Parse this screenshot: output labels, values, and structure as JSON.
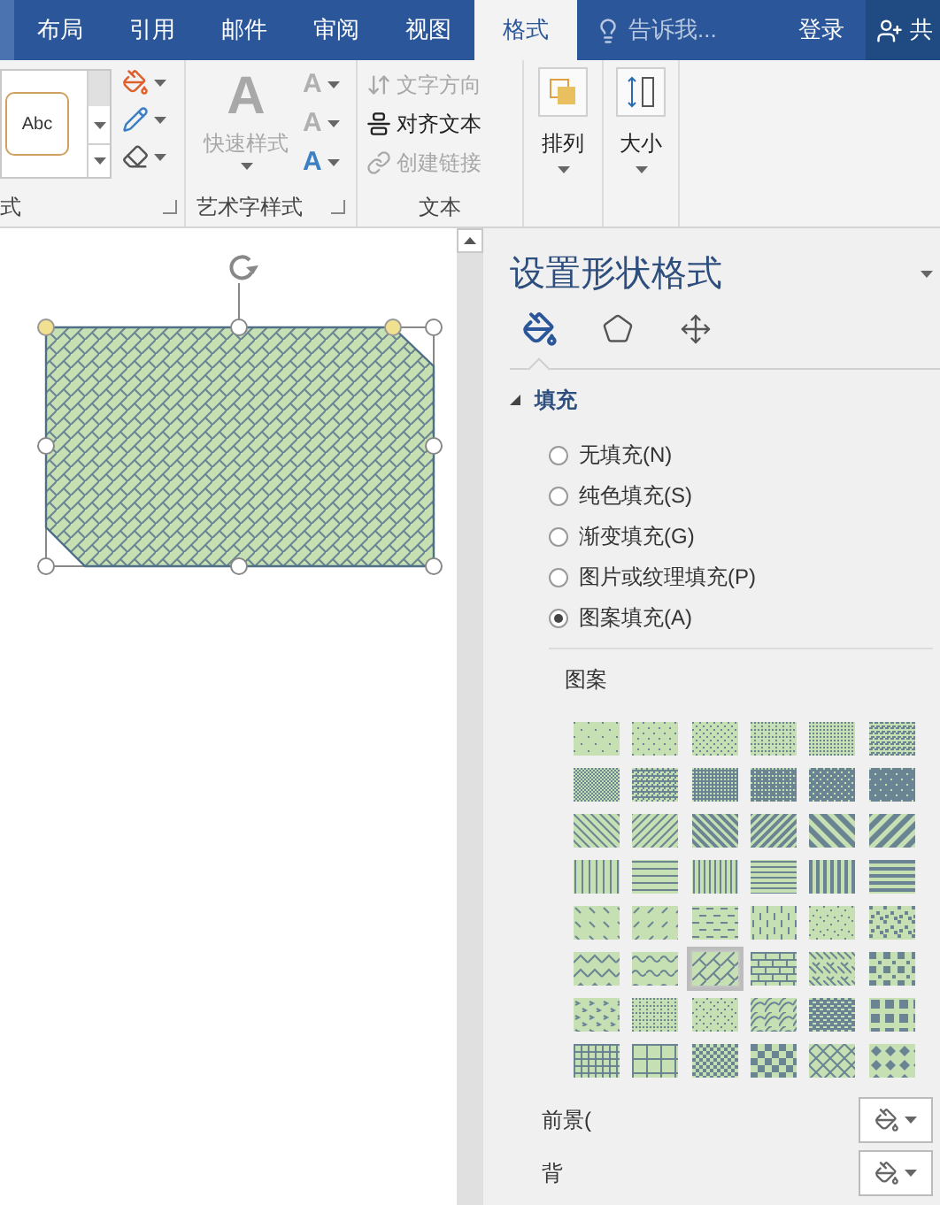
{
  "ribbon_tabs": [
    {
      "label": "布局",
      "selected": false
    },
    {
      "label": "引用",
      "selected": false
    },
    {
      "label": "邮件",
      "selected": false
    },
    {
      "label": "审阅",
      "selected": false
    },
    {
      "label": "视图",
      "selected": false
    },
    {
      "label": "格式",
      "selected": true
    }
  ],
  "tell_me": {
    "placeholder": "告诉我..."
  },
  "sign_in": "登录",
  "share": "共",
  "shape_styles": {
    "sample": "Abc",
    "label": "式"
  },
  "wordart": {
    "quick_styles": {
      "glyph": "A",
      "label": "快速样式",
      "disabled": true
    },
    "glyphs": [
      {
        "text": "A",
        "disabled": true
      },
      {
        "text": "A",
        "disabled": true
      },
      {
        "text": "A",
        "disabled": false
      }
    ],
    "label": "艺术字样式"
  },
  "text_group": {
    "items": [
      {
        "kind": "direction",
        "label": "文字方向",
        "disabled": true
      },
      {
        "kind": "align",
        "label": "对齐文本",
        "disabled": false
      },
      {
        "kind": "link",
        "label": "创建链接",
        "disabled": true
      }
    ],
    "label": "文本"
  },
  "arrange": {
    "label": "排列"
  },
  "size": {
    "label": "大小"
  },
  "pane": {
    "title": "设置形状格式",
    "icon_tabs": [
      {
        "kind": "fill",
        "selected": true
      },
      {
        "kind": "effects",
        "selected": false
      },
      {
        "kind": "layout",
        "selected": false
      }
    ],
    "fill_section": {
      "title": "填充",
      "expanded": true,
      "options": [
        {
          "label": "无填充(N)",
          "selected": false
        },
        {
          "label": "纯色填充(S)",
          "selected": false
        },
        {
          "label": "渐变填充(G)",
          "selected": false
        },
        {
          "label": "图片或纹理填充(P)",
          "selected": false
        },
        {
          "label": "图案填充(A)",
          "selected": true
        }
      ]
    },
    "pattern": {
      "label": "图案",
      "swatches": [
        {
          "kind": "dots5",
          "selected": false
        },
        {
          "kind": "dots10",
          "selected": false
        },
        {
          "kind": "dots20",
          "selected": false
        },
        {
          "kind": "dots25",
          "selected": false
        },
        {
          "kind": "dots30",
          "selected": false
        },
        {
          "kind": "dots40",
          "selected": false
        },
        {
          "kind": "dots50",
          "selected": false
        },
        {
          "kind": "dots60",
          "selected": false
        },
        {
          "kind": "dots70",
          "selected": false
        },
        {
          "kind": "dots75",
          "selected": false
        },
        {
          "kind": "dots80",
          "selected": false
        },
        {
          "kind": "dots90",
          "selected": false
        },
        {
          "kind": "ldiag",
          "selected": false
        },
        {
          "kind": "rdiag",
          "selected": false
        },
        {
          "kind": "dkdiag",
          "selected": false
        },
        {
          "kind": "dkrdiag",
          "selected": false
        },
        {
          "kind": "wdiag",
          "selected": false
        },
        {
          "kind": "wrdiag",
          "selected": false
        },
        {
          "kind": "lvert",
          "selected": false
        },
        {
          "kind": "lhorz",
          "selected": false
        },
        {
          "kind": "nvert",
          "selected": false
        },
        {
          "kind": "nhorz",
          "selected": false
        },
        {
          "kind": "dkvert",
          "selected": false
        },
        {
          "kind": "dkhorz",
          "selected": false
        },
        {
          "kind": "dashdn",
          "selected": false
        },
        {
          "kind": "dashup",
          "selected": false
        },
        {
          "kind": "dashhorz",
          "selected": false
        },
        {
          "kind": "dashvert",
          "selected": false
        },
        {
          "kind": "confetti",
          "selected": false
        },
        {
          "kind": "lconfetti",
          "selected": false
        },
        {
          "kind": "zigzag",
          "selected": false
        },
        {
          "kind": "wave",
          "selected": false
        },
        {
          "kind": "diagbrick",
          "selected": true
        },
        {
          "kind": "brick",
          "selected": false
        },
        {
          "kind": "weave",
          "selected": false
        },
        {
          "kind": "plaid",
          "selected": false
        },
        {
          "kind": "divot",
          "selected": false
        },
        {
          "kind": "dotgrid",
          "selected": false
        },
        {
          "kind": "dotdiamond",
          "selected": false
        },
        {
          "kind": "shingle",
          "selected": false
        },
        {
          "kind": "trellis",
          "selected": false
        },
        {
          "kind": "sphere",
          "selected": false
        },
        {
          "kind": "smgrid",
          "selected": false
        },
        {
          "kind": "lggrid",
          "selected": false
        },
        {
          "kind": "smcheck",
          "selected": false
        },
        {
          "kind": "lgcheck",
          "selected": false
        },
        {
          "kind": "outline",
          "selected": false
        },
        {
          "kind": "soliddiamond",
          "selected": false
        }
      ]
    },
    "foreground": {
      "label": "前景("
    },
    "background": {
      "label": "背"
    }
  }
}
